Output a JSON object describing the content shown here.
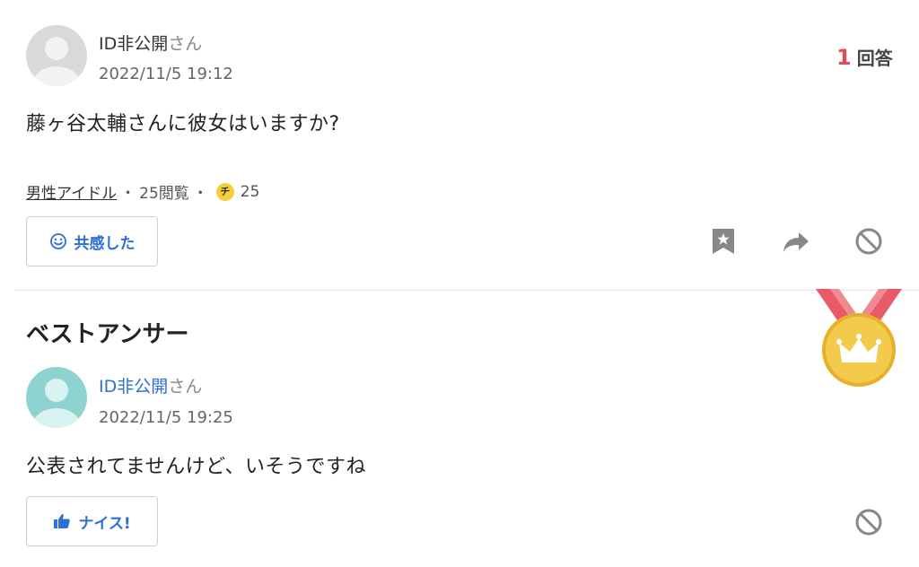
{
  "question": {
    "user_id": "ID非公開",
    "user_suffix": "さん",
    "date": "2022/11/5 19:12",
    "text": "藤ヶ谷太輔さんに彼女はいますか?",
    "answer_count_num": "1",
    "answer_count_label": "回答",
    "category": "男性アイドル",
    "views": "25閲覧",
    "separator": "・",
    "coin_glyph": "チ",
    "coins": "25",
    "empathy_label": "共感した"
  },
  "best_answer": {
    "title": "ベストアンサー",
    "user_id": "ID非公開",
    "user_suffix": "さん",
    "date": "2022/11/5 19:25",
    "text": "公表されてませんけど、いそうですね",
    "nice_label": "ナイス!"
  },
  "colors": {
    "link": "#2d6fd6",
    "accent_red": "#e64a57",
    "medal_gold": "#f0c43a",
    "ribbon": "#e85a66"
  },
  "icons": [
    "user-avatar-icon",
    "smile-icon",
    "bookmark-icon",
    "share-arrow-icon",
    "block-icon",
    "thumbs-up-icon",
    "gold-medal-icon"
  ]
}
